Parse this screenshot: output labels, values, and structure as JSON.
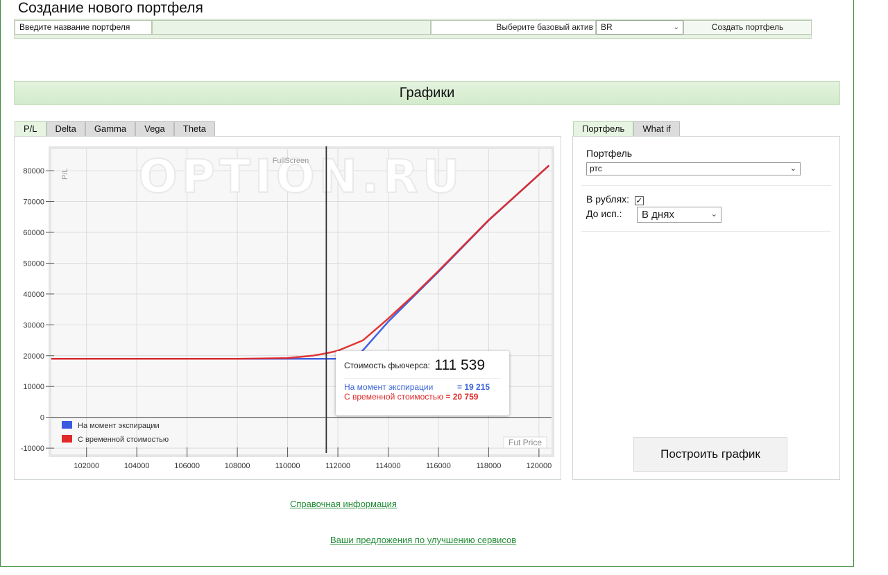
{
  "create": {
    "title": "Создание нового портфеля",
    "name_label": "Введите название портфеля",
    "name_value": "",
    "asset_label": "Выберите базовый актив",
    "asset_selected": "BR",
    "create_button": "Создать портфель"
  },
  "charts": {
    "header": "Графики",
    "tabs": [
      "P/L",
      "Delta",
      "Gamma",
      "Vega",
      "Theta"
    ],
    "active_tab": "P/L",
    "fullscreen_label": "FullScreen",
    "watermark": "OPTION.RU",
    "tooltip": {
      "title": "Стоимость фьючерса:",
      "value": "111 539",
      "row1_label": "На момент экспирации",
      "row1_value": "= 19 215",
      "row2_label": "С временной стоимостью",
      "row2_value": "= 20 759"
    }
  },
  "chart_data": {
    "type": "line",
    "xlabel": "Fut Price",
    "ylabel": "P/L",
    "xlim": [
      100600,
      120500
    ],
    "ylim": [
      -12000,
      87000
    ],
    "xticks": [
      102000,
      104000,
      106000,
      108000,
      110000,
      112000,
      114000,
      116000,
      118000,
      120000
    ],
    "yticks": [
      -10000,
      0,
      10000,
      20000,
      30000,
      40000,
      50000,
      60000,
      70000,
      80000
    ],
    "crosshair_x": 111539,
    "series": [
      {
        "name": "На момент экспирации",
        "color": "#3a5be0",
        "points": [
          [
            100600,
            19000
          ],
          [
            112700,
            19000
          ],
          [
            114000,
            31000
          ],
          [
            116000,
            47200
          ],
          [
            118000,
            63900
          ],
          [
            120400,
            81700
          ]
        ]
      },
      {
        "name": "С временной стоимостью",
        "color": "#e02a2a",
        "points": [
          [
            100600,
            19000
          ],
          [
            108000,
            19000
          ],
          [
            110000,
            19200
          ],
          [
            111000,
            20000
          ],
          [
            111539,
            20759
          ],
          [
            112000,
            21600
          ],
          [
            113000,
            25000
          ],
          [
            114000,
            32000
          ],
          [
            115000,
            39500
          ],
          [
            116000,
            47500
          ],
          [
            118000,
            64000
          ],
          [
            120400,
            81700
          ]
        ]
      }
    ],
    "legend_position": "bottom-left"
  },
  "side": {
    "tabs": [
      "Портфель",
      "What if"
    ],
    "active_tab": "Портфель",
    "portfolio_label": "Портфель",
    "portfolio_selected": "ртс",
    "rub_label": "В рублях:",
    "rub_checked": true,
    "exp_label": "До исп.:",
    "exp_selected": "В днях",
    "build_button": "Построить график"
  },
  "footer": {
    "link_help": "Справочная информация",
    "link_suggest": "Ваши предложения по улучшению сервисов"
  }
}
